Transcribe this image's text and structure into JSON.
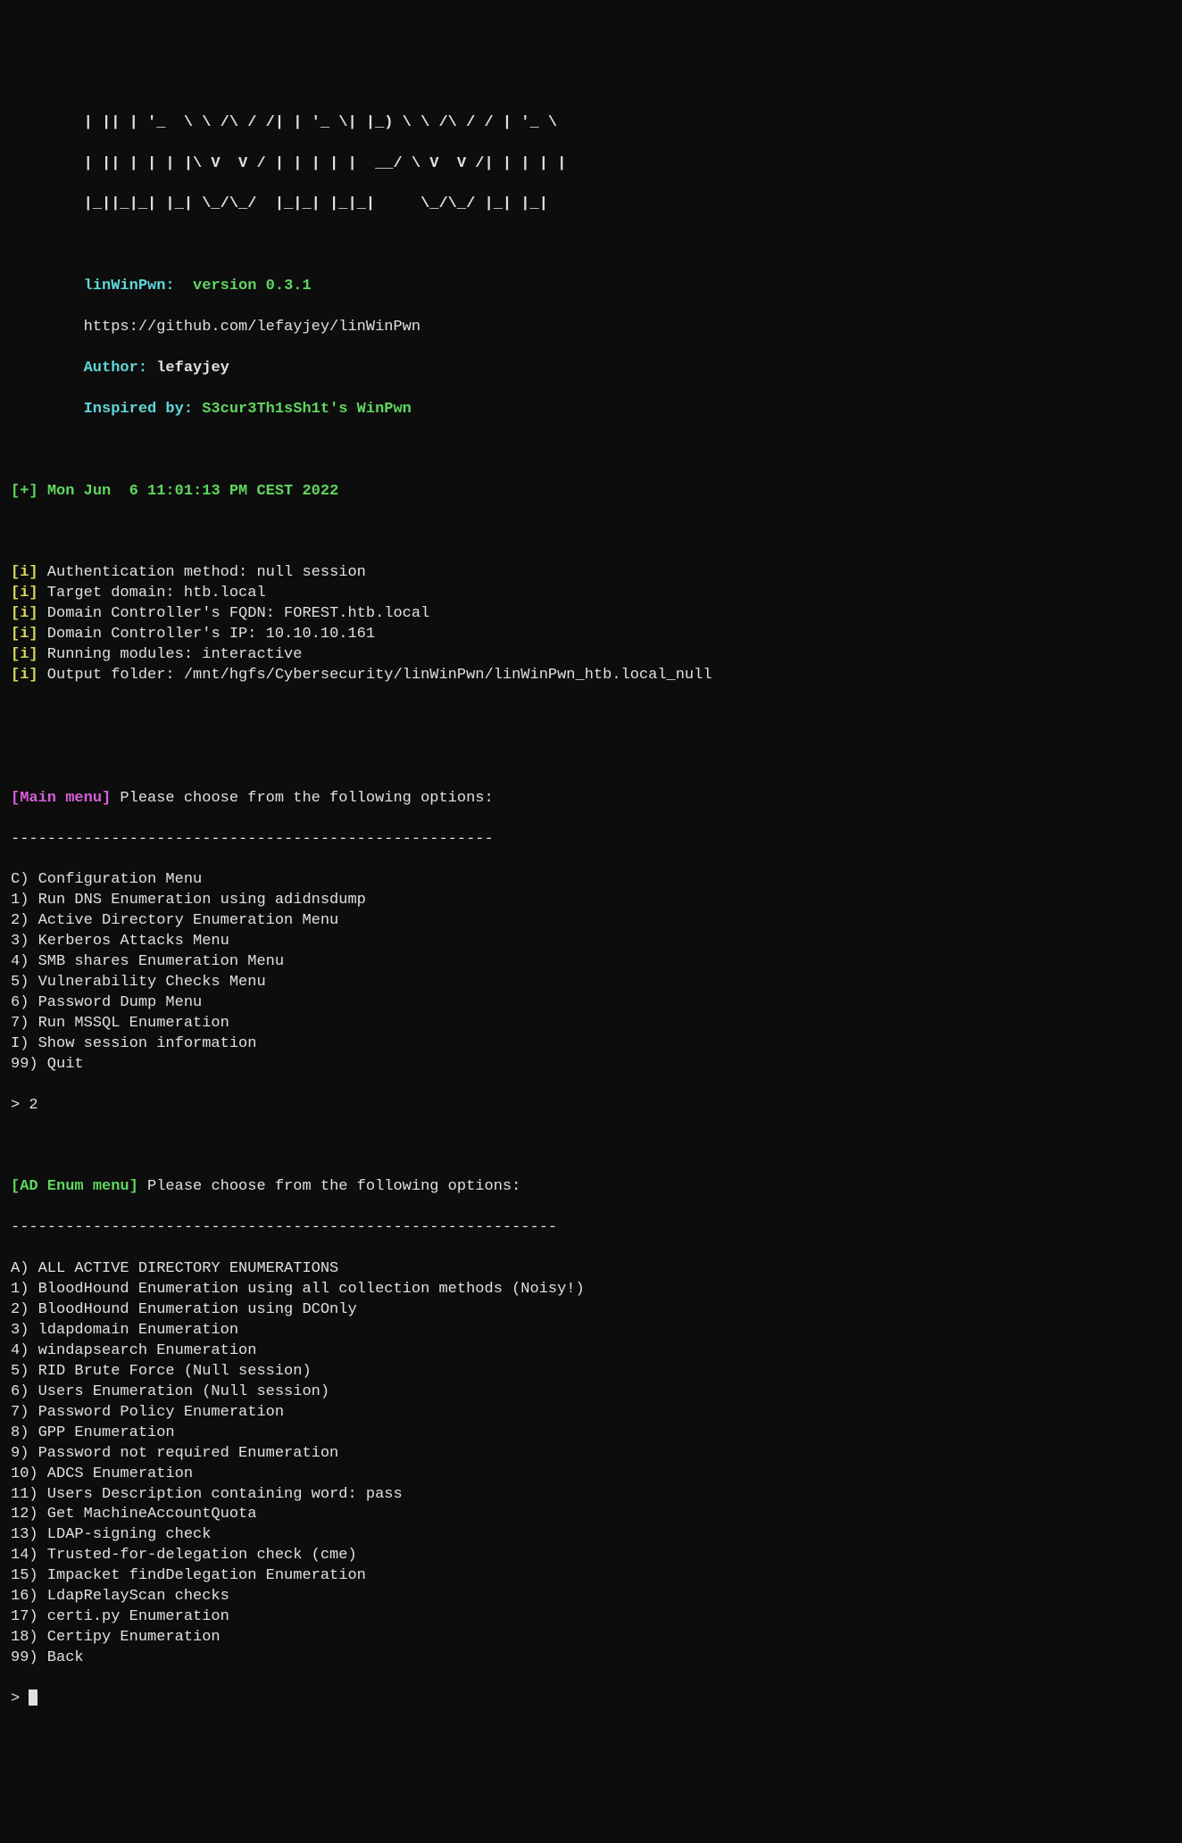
{
  "ascii": {
    "l1": "| || | '_  \\ \\ /\\ / /| | '_ \\| |_) \\ \\ /\\ / / | '_ \\",
    "l2": "| || | | | |\\ V  V / | | | | |  __/ \\ V  V /| | | | |",
    "l3": "|_||_|_| |_| \\_/\\_/  |_|_| |_|_|     \\_/\\_/ |_| |_|"
  },
  "banner": {
    "name_label": "linWinPwn:",
    "version": "version 0.3.1",
    "url": "https://github.com/lefayjey/linWinPwn",
    "author_label": "Author:",
    "author": "lefayjey",
    "inspired_label": "Inspired by:",
    "inspired": "S3cur3Th1sSh1t's WinPwn"
  },
  "timestamp": {
    "prefix": "[+]",
    "value": "Mon Jun  6 11:01:13 PM CEST 2022"
  },
  "info_prefix": "[i]",
  "info": [
    "Authentication method: null session",
    "Target domain: htb.local",
    "Domain Controller's FQDN: FOREST.htb.local",
    "Domain Controller's IP: 10.10.10.161",
    "Running modules: interactive",
    "Output folder: /mnt/hgfs/Cybersecurity/linWinPwn/linWinPwn_htb.local_null"
  ],
  "main_menu": {
    "title": "[Main menu]",
    "prompt": "Please choose from the following options:",
    "sep": "-----------------------------------------------------",
    "items": [
      "C) Configuration Menu",
      "1) Run DNS Enumeration using adidnsdump",
      "2) Active Directory Enumeration Menu",
      "3) Kerberos Attacks Menu",
      "4) SMB shares Enumeration Menu",
      "5) Vulnerability Checks Menu",
      "6) Password Dump Menu",
      "7) Run MSSQL Enumeration",
      "I) Show session information",
      "99) Quit"
    ],
    "input_prefix": ">",
    "input_value": "2"
  },
  "ad_menu": {
    "title": "[AD Enum menu]",
    "prompt": "Please choose from the following options:",
    "sep": "------------------------------------------------------------",
    "items": [
      "A) ALL ACTIVE DIRECTORY ENUMERATIONS",
      "1) BloodHound Enumeration using all collection methods (Noisy!)",
      "2) BloodHound Enumeration using DCOnly",
      "3) ldapdomain Enumeration",
      "4) windapsearch Enumeration",
      "5) RID Brute Force (Null session)",
      "6) Users Enumeration (Null session)",
      "7) Password Policy Enumeration",
      "8) GPP Enumeration",
      "9) Password not required Enumeration",
      "10) ADCS Enumeration",
      "11) Users Description containing word: pass",
      "12) Get MachineAccountQuota",
      "13) LDAP-signing check",
      "14) Trusted-for-delegation check (cme)",
      "15) Impacket findDelegation Enumeration",
      "16) LdapRelayScan checks",
      "17) certi.py Enumeration",
      "18) Certipy Enumeration",
      "99) Back"
    ],
    "input_prefix": ">"
  }
}
